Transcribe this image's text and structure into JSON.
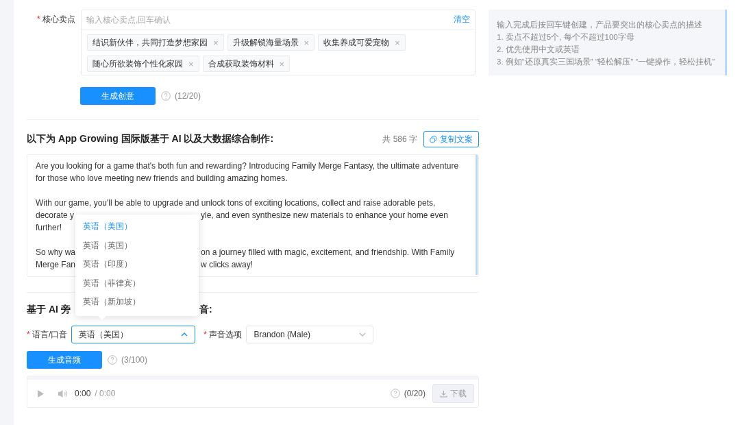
{
  "core_points": {
    "label": "核心卖点",
    "required_mark": "*",
    "placeholder": "输入核心卖点,回车确认",
    "clear": "清空",
    "tags": [
      {
        "text": "结识新伙伴，共同打造梦想家园",
        "remove": "×"
      },
      {
        "text": "升级解锁海量场景",
        "remove": "×"
      },
      {
        "text": "收集养成可爱宠物",
        "remove": "×"
      },
      {
        "text": "随心所欲装饰个性化家园",
        "remove": "×"
      },
      {
        "text": "合成获取装饰材料",
        "remove": "×"
      }
    ],
    "generate_button": "生成创意",
    "count": "(12/20)"
  },
  "hint": {
    "lines": [
      "输入完成后按回车键创建，产品要突出的核心卖点的描述",
      "1. 卖点不超过5个, 每个不超过100字母",
      "2. 优先使用中文或英语",
      "3. 例如“还原真实三国场景” “轻松解压” “一键操作，轻松挂机”"
    ]
  },
  "copy_section": {
    "heading": "以下为 App Growing 国际版基于 AI 以及大数据综合制作:",
    "char_count": "共 586 字",
    "copy_button": "复制文案",
    "paragraphs": [
      [
        {
          "left": "Are you looking for a game that's both fun and rewarding? Introducing Family Merge Fantasy, the ultimate adventure"
        },
        {
          "left": "for those who love meeting new friends and building amazing homes."
        }
      ],
      [
        {
          "left": "With our game, you'll be able to upgrade and unlock tons of exciting locations, collect and raise adorable pets,"
        },
        {
          "left": "decorate y",
          "right": "yle, and even synthesize new materials to enhance your home even"
        },
        {
          "left": "further!"
        }
      ],
      [
        {
          "left": "So why wa",
          "right": "on a journey filled with magic, excitement, and friendship. With Family"
        },
        {
          "left": "Merge Fan",
          "right": "w clicks away!"
        }
      ]
    ]
  },
  "voice_section": {
    "heading_left": "基于 AI 旁",
    "heading_right": "音:",
    "fields": [
      {
        "label": "语言/口音",
        "required_mark": "*",
        "value": "英语（美国）",
        "open": true
      },
      {
        "label": "声音选项",
        "required_mark": "*",
        "value": "Brandon (Male)",
        "open": false
      }
    ],
    "dropdown": [
      {
        "label": "英语（美国）",
        "selected": true
      },
      {
        "label": "英语（英国）",
        "selected": false
      },
      {
        "label": "英语（印度）",
        "selected": false
      },
      {
        "label": "英语（菲律宾）",
        "selected": false
      },
      {
        "label": "英语（新加坡）",
        "selected": false
      }
    ],
    "generate_button": "生成音频",
    "count": "(3/100)"
  },
  "player": {
    "current": "0:00",
    "total": "/ 0:00",
    "count": "(0/20)",
    "download": "下载"
  }
}
